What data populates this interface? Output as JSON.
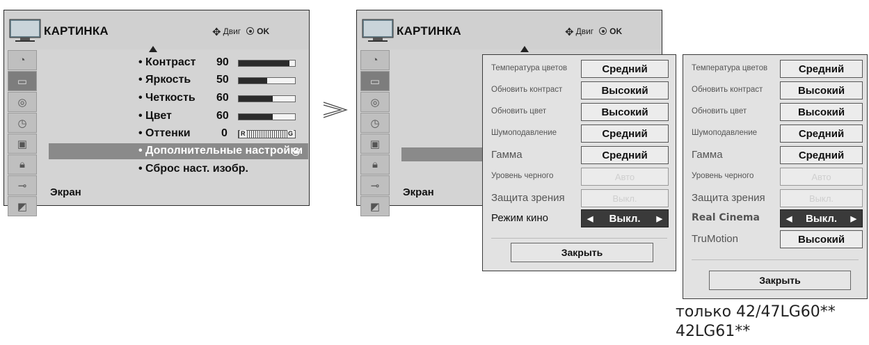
{
  "left_menu": {
    "title": "КАРТИНКА",
    "hint_move": "Двиг",
    "hint_ok": "OK",
    "sidebar_icons": [
      "sound-icon",
      "picture-icon",
      "audio-icon",
      "clock-icon",
      "option-icon",
      "lock-icon",
      "input-icon",
      "screen-icon"
    ],
    "items": [
      {
        "label": "• Контраст",
        "value": "90",
        "level": 90
      },
      {
        "label": "• Яркость",
        "value": "50",
        "level": 50
      },
      {
        "label": "• Четкость",
        "value": "60",
        "level": 60
      },
      {
        "label": "• Цвет",
        "value": "60",
        "level": 60
      },
      {
        "label": "• Оттенки",
        "value": "0",
        "tint_left": "R",
        "tint_right": "G"
      }
    ],
    "highlighted": "• Дополнительные настройки",
    "reset": "• Сброс наст. изобр.",
    "screen": "Экран"
  },
  "arrow_glyph": ">",
  "right_menu": {
    "title": "КАРТИНКА",
    "hint_move": "Двиг",
    "hint_ok": "OK",
    "screen": "Экран"
  },
  "panel_a": {
    "rows": [
      {
        "label": "Температура цветов",
        "value": "Средний"
      },
      {
        "label": "Обновить контраст",
        "value": "Высокий"
      },
      {
        "label": "Обновить цвет",
        "value": "Высокий"
      },
      {
        "label": "Шумоподавление",
        "value": "Средний"
      },
      {
        "label": "Гамма",
        "value": "Средний"
      },
      {
        "label": "Уровень черного",
        "value": "Авто"
      },
      {
        "label": "Защита зрения",
        "value": "Выкл."
      },
      {
        "label": "Режим кино",
        "value": "Выкл."
      }
    ],
    "close": "Закрыть"
  },
  "panel_b": {
    "rows": [
      {
        "label": "Температура цветов",
        "value": "Средний"
      },
      {
        "label": "Обновить контраст",
        "value": "Высокий"
      },
      {
        "label": "Обновить цвет",
        "value": "Высокий"
      },
      {
        "label": "Шумоподавление",
        "value": "Средний"
      },
      {
        "label": "Гамма",
        "value": "Средний"
      },
      {
        "label": "Уровень черного",
        "value": "Авто"
      },
      {
        "label": "Защита зрения",
        "value": "Выкл."
      },
      {
        "label": "Real Cinema",
        "value": "Выкл."
      },
      {
        "label": "TruMotion",
        "value": "Высокий"
      }
    ],
    "close": "Закрыть"
  },
  "note": {
    "line1": "только 42/47LG60**",
    "line2": "42LG61**"
  },
  "colors": {
    "osd_bg": "#d4d4d4",
    "highlight": "#8a8a8a",
    "selected_value": "#3a3a3a",
    "panel_bg": "#e2e2e2"
  }
}
